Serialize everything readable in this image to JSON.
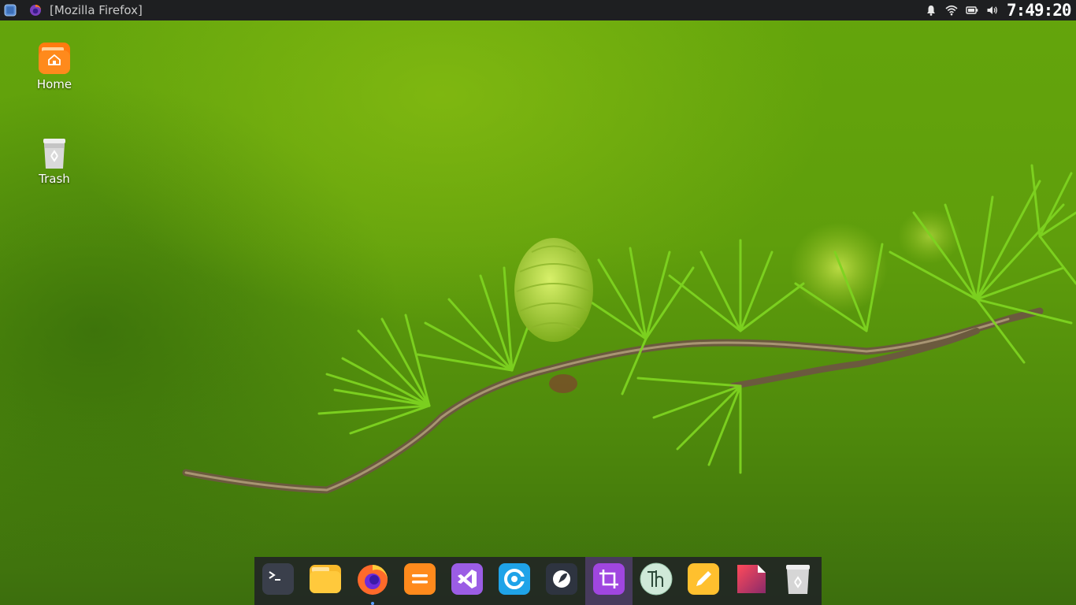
{
  "topbar": {
    "window_title": "[Mozilla Firefox]",
    "clock": "7:49:20"
  },
  "tray_icons": [
    "notification-bell-icon",
    "wifi-icon",
    "battery-icon",
    "volume-icon"
  ],
  "desktop": {
    "icons": [
      {
        "id": "home",
        "label": "Home",
        "icon": "home-folder-icon"
      },
      {
        "id": "trash",
        "label": "Trash",
        "icon": "trash-icon"
      }
    ]
  },
  "dock": {
    "items": [
      {
        "icon": "terminal-icon"
      },
      {
        "icon": "files-icon"
      },
      {
        "icon": "firefox-icon",
        "running": true
      },
      {
        "icon": "calculator-icon"
      },
      {
        "icon": "visual-studio-icon"
      },
      {
        "icon": "browser-icon"
      },
      {
        "icon": "launcher-icon"
      },
      {
        "icon": "crop-screenshot-icon",
        "active": true
      },
      {
        "icon": "font-viewer-icon"
      },
      {
        "icon": "notes-icon"
      },
      {
        "icon": "document-viewer-icon"
      },
      {
        "icon": "trash-icon"
      }
    ]
  },
  "colors": {
    "panel": "#1e1f21",
    "accent": "#5aa0ff",
    "wallpaper_green": "#5f9e0c"
  }
}
